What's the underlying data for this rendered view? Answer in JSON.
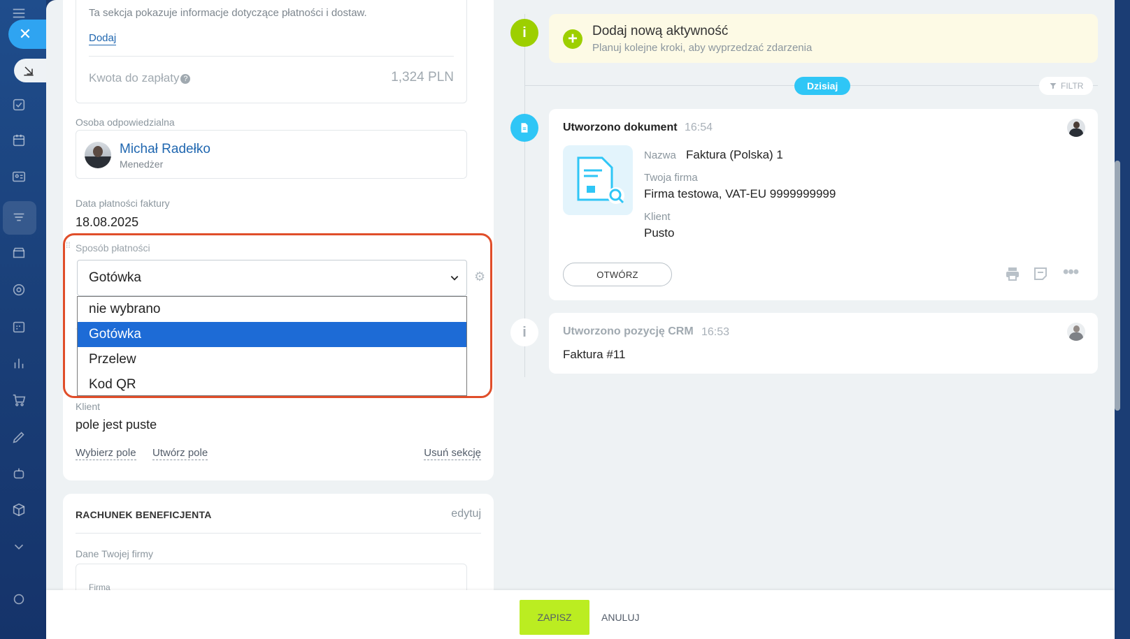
{
  "left_panel": {
    "payment_info_text": "Ta sekcja pokazuje informacje dotyczące płatności i dostaw.",
    "add_link": "Dodaj",
    "amount_label": "Kwota do zapłaty",
    "amount_value": "1,324 PLN",
    "responsible_label": "Osoba odpowiedzialna",
    "responsible_name": "Michał Radełko",
    "responsible_role": "Menedżer",
    "due_date_label": "Data płatności faktury",
    "due_date_value": "18.08.2025",
    "payment_method_label": "Sposób płatności",
    "payment_method_selected": "Gotówka",
    "payment_method_options": [
      "nie wybrano",
      "Gotówka",
      "Przelew",
      "Kod QR"
    ],
    "edit_partial": "tuj",
    "client_label": "Klient",
    "client_value": "pole jest puste",
    "select_field_link": "Wybierz pole",
    "create_field_link": "Utwórz pole",
    "remove_section_link": "Usuń sekcję",
    "beneficiary_title": "RACHUNEK BENEFICJENTA",
    "beneficiary_edit": "edytuj",
    "company_data_label": "Dane Twojej firmy",
    "company_field_label": "Firma"
  },
  "timeline": {
    "new_activity_title": "Dodaj nową aktywność",
    "new_activity_subtitle": "Planuj kolejne kroki, aby wyprzedzać zdarzenia",
    "today_label": "Dzisiaj",
    "filter_label": "FILTR",
    "doc_event": {
      "title": "Utworzono dokument",
      "time": "16:54",
      "name_label": "Nazwa",
      "name_value": "Faktura (Polska) 1",
      "company_label": "Twoja firma",
      "company_value": "Firma testowa, VAT-EU 9999999999",
      "client_label": "Klient",
      "client_value": "Pusto",
      "open_button": "OTWÓRZ"
    },
    "crm_event": {
      "title": "Utworzono pozycję CRM",
      "time": "16:53",
      "body": "Faktura #11"
    }
  },
  "footer": {
    "save_label": "ZAPISZ",
    "cancel_label": "ANULUJ"
  },
  "colors": {
    "accent_blue": "#2fc6f6",
    "save_green": "#bbed21",
    "highlight_red": "#e04e2a",
    "selected_option": "#1d6bd6"
  }
}
